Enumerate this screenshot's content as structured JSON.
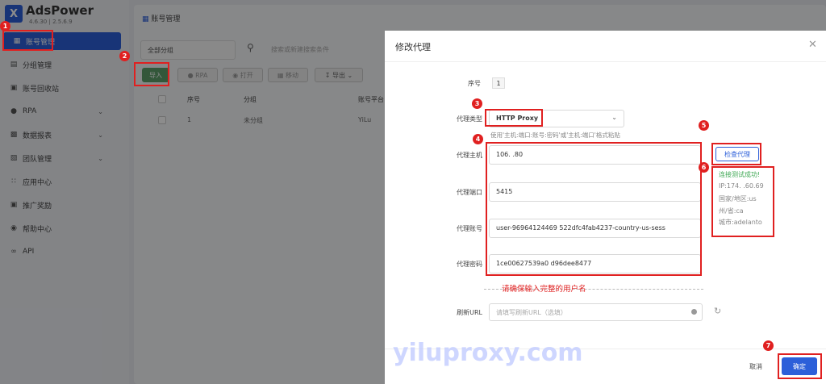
{
  "app": {
    "name": "AdsPower",
    "version": "4.6.30 | 2.5.6.9",
    "logo_letter": "X"
  },
  "sidebar": {
    "items": [
      {
        "label": "账号管理",
        "icon": "list-icon",
        "active": true
      },
      {
        "label": "分组管理",
        "icon": "folder-icon"
      },
      {
        "label": "账号回收站",
        "icon": "trash-icon"
      },
      {
        "label": "RPA",
        "icon": "robot-icon",
        "expandable": true
      },
      {
        "label": "数据报表",
        "icon": "chart-icon",
        "expandable": true
      },
      {
        "label": "团队管理",
        "icon": "team-icon",
        "expandable": true
      },
      {
        "label": "应用中心",
        "icon": "grid-icon"
      },
      {
        "label": "推广奖励",
        "icon": "gift-icon"
      },
      {
        "label": "帮助中心",
        "icon": "help-icon"
      },
      {
        "label": "API",
        "icon": "api-icon"
      }
    ]
  },
  "main": {
    "breadcrumb": "账号管理",
    "group_select": "全部分组",
    "search_placeholder": "搜索或新建搜索条件",
    "toolbar": {
      "import": "导入",
      "rpa": "RPA",
      "open": "打开",
      "move": "移动",
      "export": "导出"
    },
    "table": {
      "headers": [
        "序号",
        "分组",
        "账号平台"
      ],
      "rows": [
        {
          "seq": "1",
          "group": "未分组",
          "platform": "YiLu"
        }
      ]
    }
  },
  "modal": {
    "title": "修改代理",
    "seq_label": "序号",
    "seq_value": "1",
    "proxy_type_label": "代理类型",
    "proxy_type_value": "HTTP Proxy",
    "hint": "使用'主机:端口:账号:密码'或'主机:端口'格式粘贴",
    "host_label": "代理主机",
    "host_value": "106.    .80",
    "port_label": "代理端口",
    "port_value": "5415",
    "account_label": "代理账号",
    "account_value": "user-96964124469          522dfc4fab4237-country-us-sess",
    "password_label": "代理密码",
    "password_value": "1ce00627539a0          d96dee8477",
    "warning": "请确保输入完整的用户名",
    "refresh_url_label": "刷新URL",
    "refresh_url_placeholder": "请填写刷新URL（选填）",
    "check_button": "检查代理",
    "result": {
      "status": "连接测试成功!",
      "ip": "IP:174.    .60.69",
      "country": "国家/地区:us",
      "state": "州/省:ca",
      "city": "城市:adelanto"
    },
    "cancel": "取消",
    "confirm": "确定"
  },
  "annotations": [
    "1",
    "2",
    "3",
    "4",
    "5",
    "6",
    "7"
  ],
  "watermark": "yiluproxy.com",
  "colors": {
    "accent": "#2c5fd9",
    "import_green": "#5d9f6b",
    "annotation_red": "#e02020",
    "success_green": "#3fa854"
  }
}
